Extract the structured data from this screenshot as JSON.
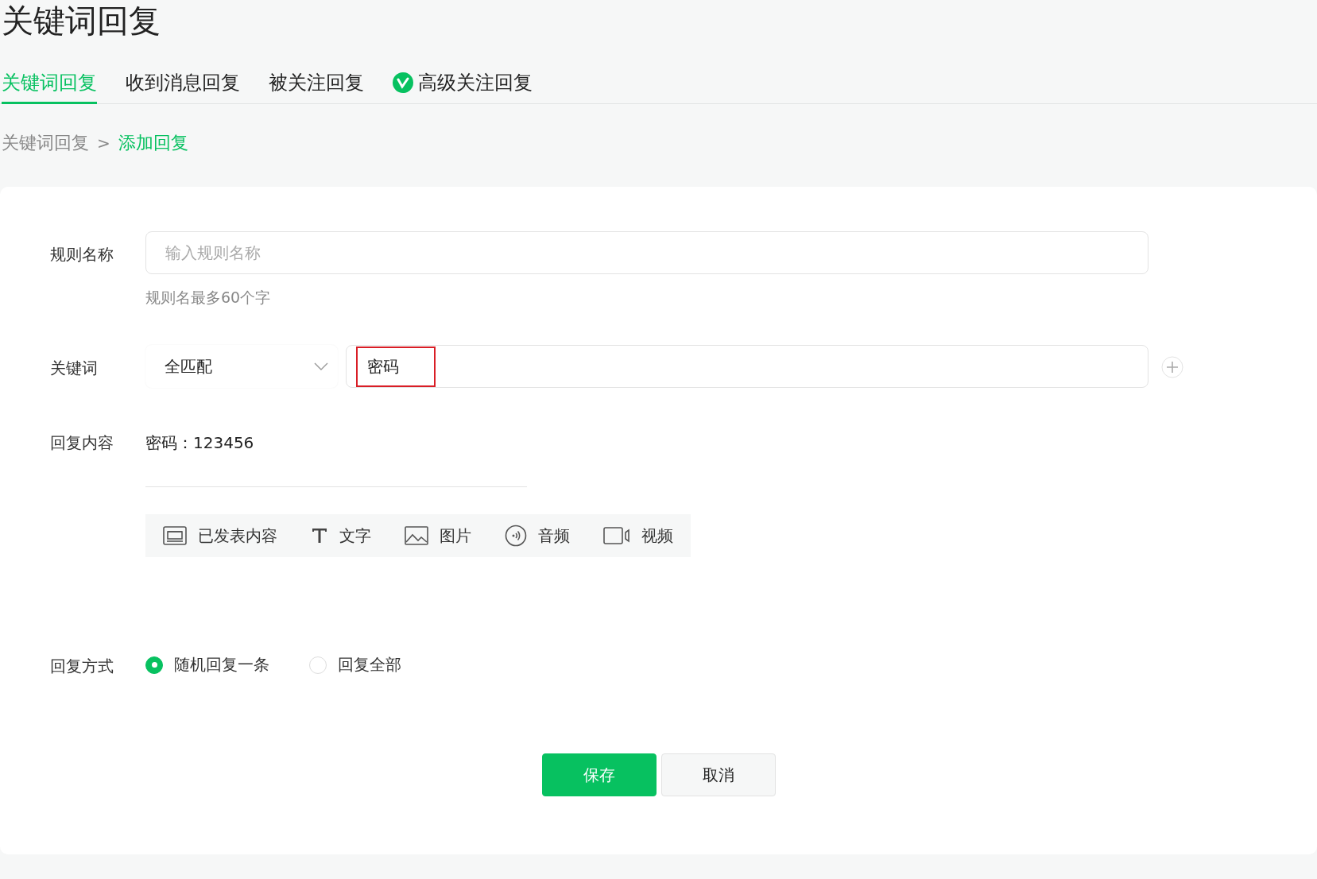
{
  "page_title": "关键词回复",
  "tabs": [
    {
      "label": "关键词回复",
      "selected": true,
      "badge": false
    },
    {
      "label": "收到消息回复",
      "selected": false,
      "badge": false
    },
    {
      "label": "被关注回复",
      "selected": false,
      "badge": false
    },
    {
      "label": "高级关注回复",
      "selected": false,
      "badge": true
    }
  ],
  "breadcrumb": [
    {
      "label": "关键词回复",
      "current": false
    },
    {
      "separator": ">"
    },
    {
      "label": "添加回复",
      "current": true
    }
  ],
  "form": {
    "rule_name": {
      "label": "规则名称",
      "placeholder": "输入规则名称",
      "hint": "规则名最多60个字"
    },
    "keyword": {
      "label": "关键词",
      "match_type": "全匹配",
      "value": "密码",
      "highlighted": true
    },
    "reply_content": {
      "label": "回复内容",
      "text": "密码：123456",
      "tools": [
        {
          "kind": "published",
          "label": "已发表内容"
        },
        {
          "kind": "text",
          "label": "文字"
        },
        {
          "kind": "image",
          "label": "图片"
        },
        {
          "kind": "audio",
          "label": "音频"
        },
        {
          "kind": "video",
          "label": "视频"
        }
      ]
    },
    "reply_mode": {
      "label": "回复方式",
      "options": [
        {
          "label": "随机回复一条",
          "selected": true
        },
        {
          "label": "回复全部",
          "selected": false
        }
      ]
    }
  },
  "buttons": [
    {
      "kind": "primary",
      "label": "保存"
    },
    {
      "kind": "secondary",
      "label": "取消"
    }
  ]
}
